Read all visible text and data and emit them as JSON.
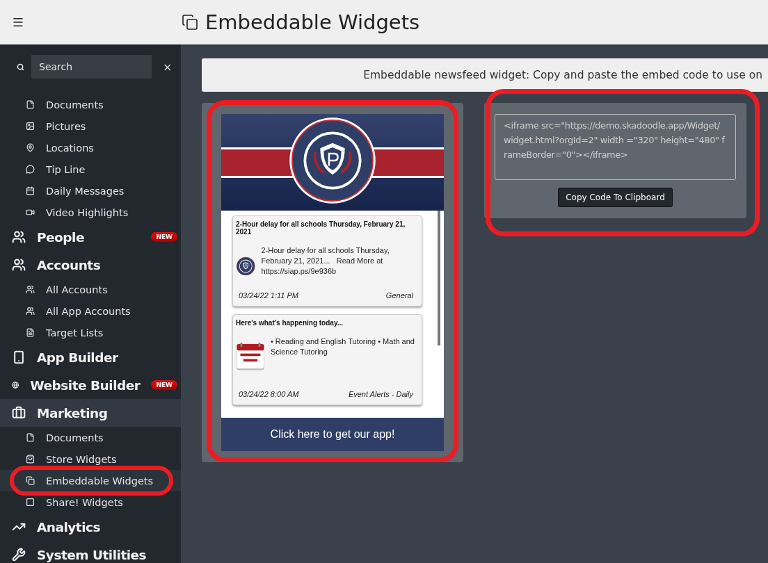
{
  "header": {
    "title": "Embeddable Widgets"
  },
  "sidebar": {
    "search": {
      "placeholder": "Search",
      "clear": "×"
    },
    "groups": [
      {
        "children": [
          {
            "label": "Documents",
            "selected": false
          },
          {
            "label": "Pictures",
            "selected": false
          },
          {
            "label": "Locations",
            "selected": false
          },
          {
            "label": "Tip Line",
            "selected": false
          },
          {
            "label": "Daily Messages",
            "selected": false
          },
          {
            "label": "Video Highlights",
            "selected": false
          }
        ]
      },
      {
        "label": "People",
        "badge": "NEW",
        "selected": false
      },
      {
        "label": "Accounts",
        "selected": false,
        "children": [
          {
            "label": "All Accounts",
            "selected": false
          },
          {
            "label": "All App Accounts",
            "selected": false
          },
          {
            "label": "Target Lists",
            "selected": false
          }
        ]
      },
      {
        "label": "App Builder",
        "selected": false
      },
      {
        "label": "Website Builder",
        "badge": "NEW",
        "selected": false
      },
      {
        "label": "Marketing",
        "selected": true,
        "children": [
          {
            "label": "Documents",
            "selected": false
          },
          {
            "label": "Store Widgets",
            "selected": false
          },
          {
            "label": "Embeddable Widgets",
            "selected": true,
            "highlighted": true
          },
          {
            "label": "Share! Widgets",
            "selected": false
          }
        ]
      },
      {
        "label": "Analytics",
        "selected": false
      },
      {
        "label": "System Utilities",
        "selected": false
      }
    ]
  },
  "banner": {
    "text": "Embeddable newsfeed widget: Copy and paste the embed code to use on"
  },
  "widget_preview": {
    "highlighted": true,
    "cards": [
      {
        "title": "2-Hour delay for all schools Thursday, February 21, 2021",
        "kind": "seal",
        "body": "2-Hour delay for all schools Thursday, February 21, 2021...   Read More at https://siap.ps/9e936b",
        "date": "03/24/22 1:11 PM",
        "category": "General"
      },
      {
        "title": "Here's what's happening today...",
        "kind": "calendar",
        "body": "• Reading and English Tutoring • Math and Science Tutoring",
        "date": "03/24/22 8:00 AM",
        "category": "Event Alerts - Daily"
      }
    ],
    "footer_button": "Click here to get our app!"
  },
  "embed_code": {
    "highlighted": true,
    "code": "<iframe src=\"https://demo.skadoodle.app/Widget/widget.html?orgId=2\" width =\"320\" height=\"480\" frameBorder=\"0\"></iframe>",
    "button": "Copy Code To Clipboard"
  }
}
